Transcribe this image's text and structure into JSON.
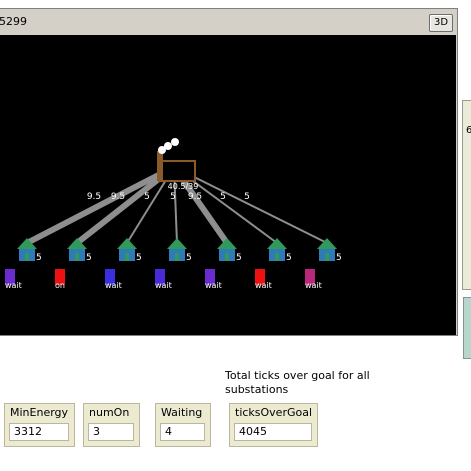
{
  "view": {
    "title": "5299",
    "three_d_label": "3D"
  },
  "plant": {
    "label": "40.5/39",
    "color": "#8b5a2b"
  },
  "links": [
    {
      "label": "9.5"
    },
    {
      "label": "9.5"
    },
    {
      "label": "5"
    },
    {
      "label": "5"
    },
    {
      "label": "9.5"
    },
    {
      "label": "5"
    },
    {
      "label": "5"
    }
  ],
  "houses": [
    {
      "label": "5",
      "switch_label": "wait",
      "switch_color": "#6a2ccf"
    },
    {
      "label": "5",
      "switch_label": "on",
      "switch_color": "#ee1111"
    },
    {
      "label": "5",
      "switch_label": "wait",
      "switch_color": "#3a2fe0"
    },
    {
      "label": "5",
      "switch_label": "wait",
      "switch_color": "#4a2ad8"
    },
    {
      "label": "5",
      "switch_label": "wait",
      "switch_color": "#6a2ccf"
    },
    {
      "label": "5",
      "switch_label": "wait",
      "switch_color": "#ee1111"
    },
    {
      "label": "5",
      "switch_label": "wait",
      "switch_color": "#b8277a"
    }
  ],
  "right_panel": {
    "text": "6"
  },
  "note": "Total ticks over goal for all substations",
  "monitors": {
    "min_energy": {
      "label": "MinEnergy",
      "value": "3312"
    },
    "num_on": {
      "label": "numOn",
      "value": "3"
    },
    "waiting": {
      "label": "Waiting",
      "value": "4"
    },
    "ticks_over_goal": {
      "label": "ticksOverGoal",
      "value": "4045"
    }
  }
}
